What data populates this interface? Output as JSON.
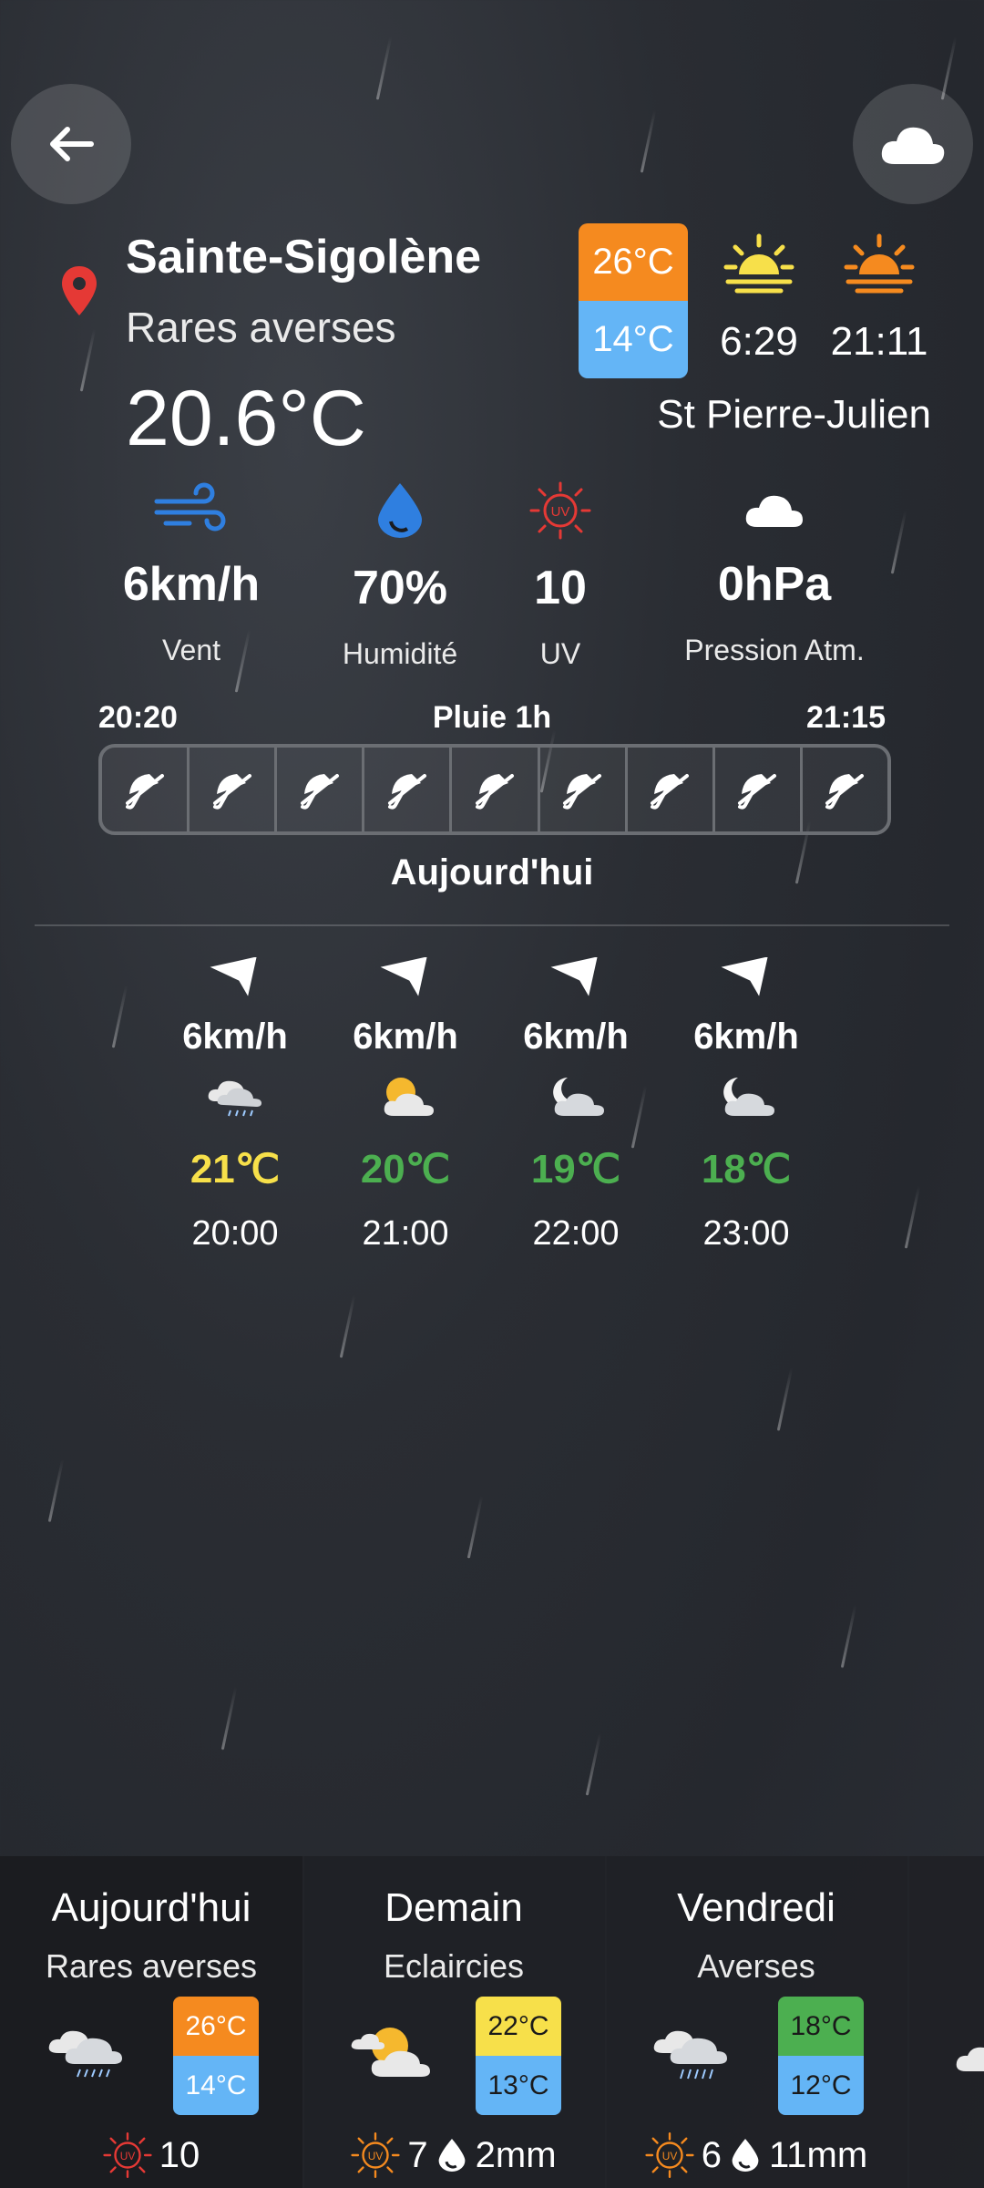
{
  "header": {
    "city": "Sainte-Sigolène",
    "condition": "Rares averses",
    "temperature": "20.6°C",
    "high": "26°C",
    "low": "14°C",
    "sunrise": "6:29",
    "sunset": "21:11",
    "station": "St Pierre-Julien"
  },
  "stats": [
    {
      "value": "6km/h",
      "label": "Vent",
      "icon": "wind-icon"
    },
    {
      "value": "70%",
      "label": "Humidité",
      "icon": "humidity-drop-icon"
    },
    {
      "value": "10",
      "label": "UV",
      "icon": "uv-icon"
    },
    {
      "value": "0hPa",
      "label": "Pression Atm.",
      "icon": "cloud-icon"
    }
  ],
  "rain": {
    "start": "20:20",
    "title": "Pluie 1h",
    "end": "21:15",
    "cells": 9
  },
  "today": {
    "title": "Aujourd'hui",
    "hours": [
      {
        "wind": "6km/h",
        "temp": "21℃",
        "time": "20:00",
        "icon": "rain-cloud-icon",
        "color": "#f7e04a"
      },
      {
        "wind": "6km/h",
        "temp": "20℃",
        "time": "21:00",
        "icon": "partly-sunny-icon",
        "color": "#4caf50"
      },
      {
        "wind": "6km/h",
        "temp": "19℃",
        "time": "22:00",
        "icon": "night-cloud-icon",
        "color": "#4caf50"
      },
      {
        "wind": "6km/h",
        "temp": "18℃",
        "time": "23:00",
        "icon": "night-cloud-icon",
        "color": "#4caf50"
      }
    ]
  },
  "days": [
    {
      "day": "Aujourd'hui",
      "condition": "Rares averses",
      "high": "26°C",
      "low": "14°C",
      "uv": "10",
      "rain": "",
      "high_color": "#f58a1f",
      "low_color": "#64b5f6"
    },
    {
      "day": "Demain",
      "condition": "Eclaircies",
      "high": "22°C",
      "low": "13°C",
      "uv": "7",
      "rain": "2mm",
      "high_color": "#f7e04a",
      "low_color": "#64b5f6"
    },
    {
      "day": "Vendredi",
      "condition": "Averses",
      "high": "18°C",
      "low": "12°C",
      "uv": "6",
      "rain": "11mm",
      "high_color": "#4caf50",
      "low_color": "#64b5f6"
    }
  ]
}
